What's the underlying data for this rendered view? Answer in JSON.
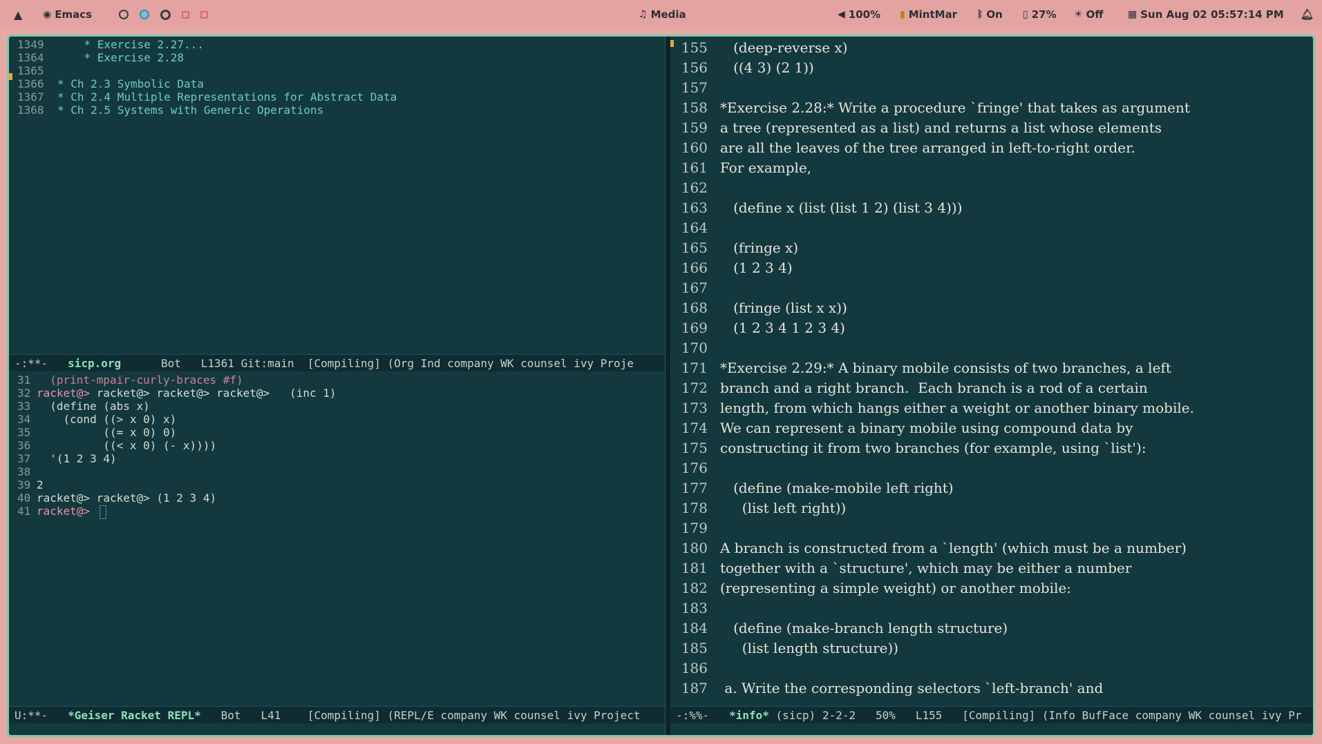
{
  "topbar": {
    "launcher_icon": "arch-logo-icon",
    "app": "Emacs",
    "media": "Media",
    "volume": "100%",
    "keyboard": "MintMar",
    "bluetooth": "On",
    "battery": "27%",
    "brightness": "Off",
    "datetime": "Sun Aug 02 05:57:14 PM"
  },
  "org": {
    "lines": [
      {
        "n": "1349",
        "text": "    * Exercise 2.27..."
      },
      {
        "n": "1364",
        "text": "    * Exercise 2.28"
      },
      {
        "n": "1365",
        "text": ""
      },
      {
        "n": "1366",
        "text": "* Ch 2.3 Symbolic Data"
      },
      {
        "n": "1367",
        "text": "* Ch 2.4 Multiple Representations for Abstract Data"
      },
      {
        "n": "1368",
        "text": "* Ch 2.5 Systems with Generic Operations"
      }
    ],
    "modeline": {
      "status": "-:**-",
      "buffer": "sicp.org",
      "pos": "Bot",
      "line": "L1361",
      "vc": "Git:main",
      "rest": "[Compiling] (Org Ind company WK counsel ivy Proje"
    }
  },
  "repl": {
    "lines": [
      {
        "n": "31",
        "prompt": "",
        "text": "  (print-mpair-curly-braces #f)",
        "muted": true
      },
      {
        "n": "32",
        "prompt": "racket@> ",
        "text": "racket@> racket@> racket@>   (inc 1)"
      },
      {
        "n": "33",
        "prompt": "",
        "text": "  (define (abs x)"
      },
      {
        "n": "34",
        "prompt": "",
        "text": "    (cond ((> x 0) x)"
      },
      {
        "n": "35",
        "prompt": "",
        "text": "          ((= x 0) 0)"
      },
      {
        "n": "36",
        "prompt": "",
        "text": "          ((< x 0) (- x))))"
      },
      {
        "n": "37",
        "prompt": "",
        "text": "  '(1 2 3 4)"
      },
      {
        "n": "38",
        "prompt": "",
        "text": ""
      },
      {
        "n": "39",
        "prompt": "",
        "text": "2"
      },
      {
        "n": "40",
        "prompt": "",
        "text": "racket@> racket@> (1 2 3 4)"
      },
      {
        "n": "41",
        "prompt": "racket@> ",
        "text": ""
      }
    ],
    "modeline": {
      "status": "U:**-",
      "buffer": "*Geiser Racket REPL*",
      "pos": "Bot",
      "line": "L41",
      "rest": "[Compiling] (REPL/E company WK counsel ivy Project"
    }
  },
  "info": {
    "lines": [
      {
        "n": "155",
        "text": "   (deep-reverse x)"
      },
      {
        "n": "156",
        "text": "   ((4 3) (2 1))"
      },
      {
        "n": "157",
        "text": ""
      },
      {
        "n": "158",
        "text": "*Exercise 2.28:* Write a procedure `fringe' that takes as argument"
      },
      {
        "n": "159",
        "text": "a tree (represented as a list) and returns a list whose elements"
      },
      {
        "n": "160",
        "text": "are all the leaves of the tree arranged in left-to-right order."
      },
      {
        "n": "161",
        "text": "For example,"
      },
      {
        "n": "162",
        "text": ""
      },
      {
        "n": "163",
        "text": "   (define x (list (list 1 2) (list 3 4)))"
      },
      {
        "n": "164",
        "text": ""
      },
      {
        "n": "165",
        "text": "   (fringe x)"
      },
      {
        "n": "166",
        "text": "   (1 2 3 4)"
      },
      {
        "n": "167",
        "text": ""
      },
      {
        "n": "168",
        "text": "   (fringe (list x x))"
      },
      {
        "n": "169",
        "text": "   (1 2 3 4 1 2 3 4)"
      },
      {
        "n": "170",
        "text": ""
      },
      {
        "n": "171",
        "text": "*Exercise 2.29:* A binary mobile consists of two branches, a left"
      },
      {
        "n": "172",
        "text": "branch and a right branch.  Each branch is a rod of a certain"
      },
      {
        "n": "173",
        "text": "length, from which hangs either a weight or another binary mobile."
      },
      {
        "n": "174",
        "text": "We can represent a binary mobile using compound data by"
      },
      {
        "n": "175",
        "text": "constructing it from two branches (for example, using `list'):"
      },
      {
        "n": "176",
        "text": ""
      },
      {
        "n": "177",
        "text": "   (define (make-mobile left right)"
      },
      {
        "n": "178",
        "text": "     (list left right))"
      },
      {
        "n": "179",
        "text": ""
      },
      {
        "n": "180",
        "text": "A branch is constructed from a `length' (which must be a number)"
      },
      {
        "n": "181",
        "text": "together with a `structure', which may be either a number"
      },
      {
        "n": "182",
        "text": "(representing a simple weight) or another mobile:"
      },
      {
        "n": "183",
        "text": ""
      },
      {
        "n": "184",
        "text": "   (define (make-branch length structure)"
      },
      {
        "n": "185",
        "text": "     (list length structure))"
      },
      {
        "n": "186",
        "text": ""
      },
      {
        "n": "187",
        "text": " a. Write the corresponding selectors `left-branch' and"
      }
    ],
    "modeline": {
      "status": "-:%%-",
      "buffer": "*info*",
      "node": "(sicp) 2-2-2",
      "pct": "50%",
      "line": "L155",
      "rest": "[Compiling] (Info BufFace company WK counsel ivy Pr"
    }
  }
}
